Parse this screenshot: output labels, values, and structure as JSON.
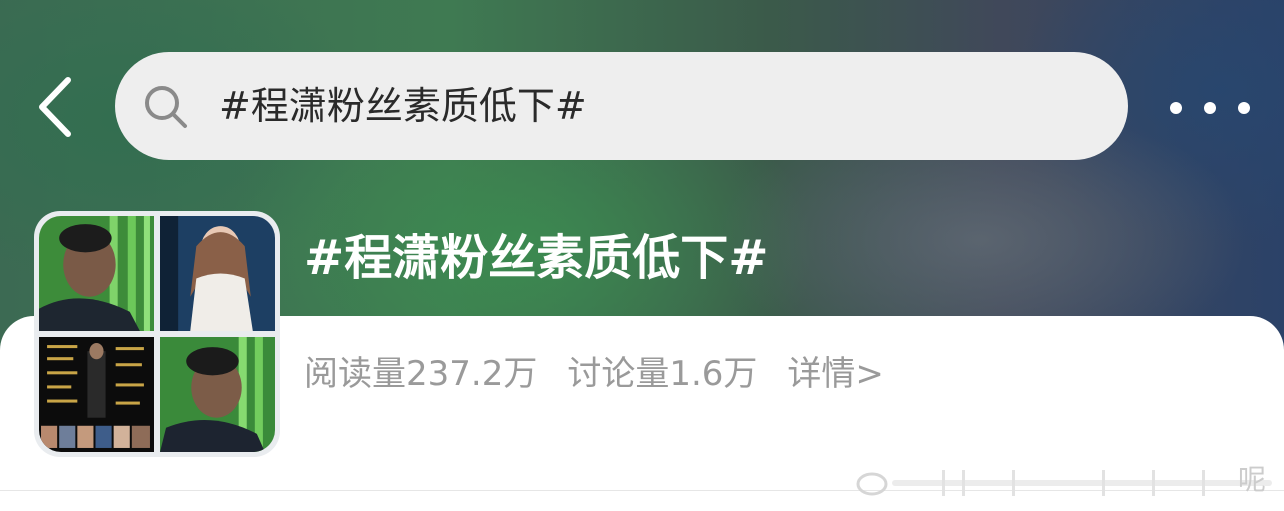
{
  "header": {
    "back_icon": "chevron-left-icon",
    "search": {
      "icon": "search-icon",
      "query": "#程潇粉丝素质低下#"
    },
    "more_icon": "more-horizontal-icon"
  },
  "topic": {
    "title": "#程潇粉丝素质低下#",
    "reads": "阅读量237.2万",
    "discussions": "讨论量1.6万",
    "details_link": "详情>"
  },
  "watermark": {
    "text": "呢"
  },
  "colors": {
    "stats_text": "#9a9a9a",
    "search_bg": "#eeeeee",
    "title_text": "#ffffff"
  }
}
